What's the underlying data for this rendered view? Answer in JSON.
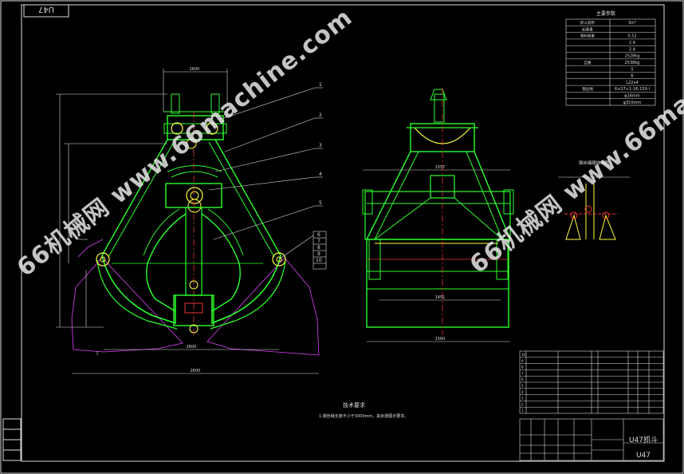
{
  "drawing": {
    "code_box": "U47",
    "part_numbers": [
      "1",
      "2",
      "3",
      "4",
      "5",
      "6",
      "7",
      "8",
      "9",
      "10"
    ],
    "params_title": "主要参数",
    "params": [
      {
        "label": "抓斗容积",
        "value": "3m³"
      },
      {
        "label": "起重量",
        "value": ""
      },
      {
        "label": "物料容重",
        "value": "0.52"
      },
      {
        "label": "",
        "value": "2.4"
      },
      {
        "label": "",
        "value": "2.4"
      },
      {
        "label": "",
        "value": "2528kg"
      },
      {
        "label": "自重",
        "value": "2538kg"
      },
      {
        "label": "",
        "value": "5"
      },
      {
        "label": "",
        "value": "6"
      },
      {
        "label": "",
        "value": "L22x4"
      },
      {
        "label": "钢丝绳",
        "value": "6×37+1-16-150-I"
      },
      {
        "label": "",
        "value": "φ16mm"
      },
      {
        "label": "",
        "value": "φ310mm"
      }
    ],
    "tech_req_title": "技术要求",
    "tech_req_text": "1.钢丝绳长度不小于3000mm，其余按图示要求。",
    "detail_title": "钢丝绳缠绕简图",
    "title_block_name": "U47抓斗",
    "title_block_code": "U47",
    "dim_labels": {
      "top_width": "2600",
      "bottom_width": "2600",
      "side_width": "1560",
      "side_top": "1557",
      "side_mid": "1451"
    }
  },
  "watermarks": [
    "66机械网 www.66machine.com",
    "66机械网 www.66machine.com"
  ]
}
